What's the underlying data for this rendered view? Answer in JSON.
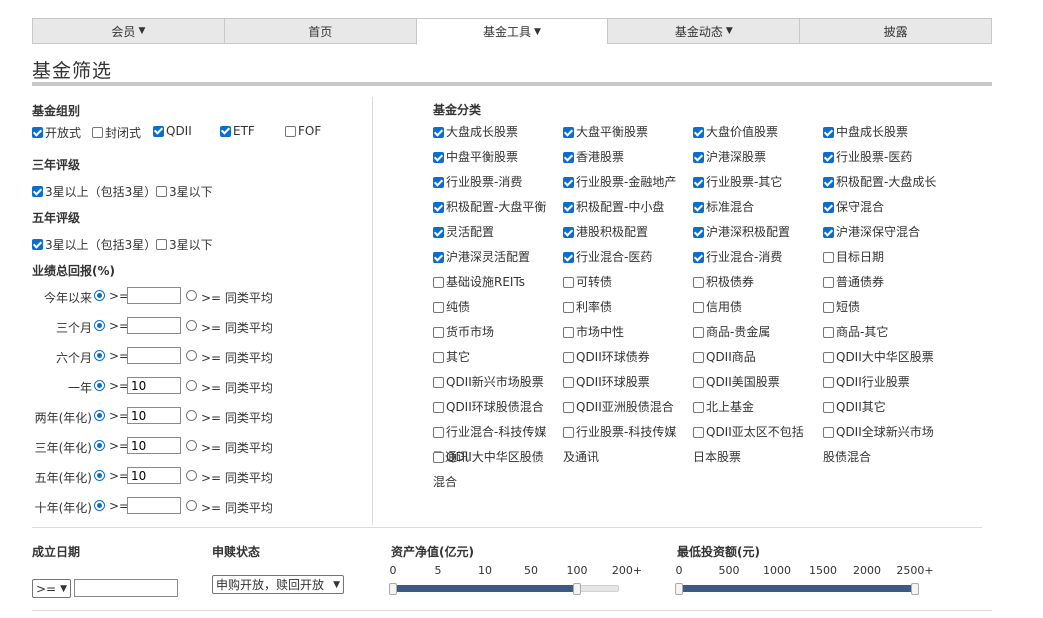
{
  "nav": {
    "tabs": [
      {
        "label": "会员",
        "dropdown": true
      },
      {
        "label": "首页",
        "dropdown": false
      },
      {
        "label": "基金工具",
        "dropdown": true,
        "active": true
      },
      {
        "label": "基金动态",
        "dropdown": true
      },
      {
        "label": "披露",
        "dropdown": false
      }
    ]
  },
  "page_title": "基金筛选",
  "fund_group": {
    "title": "基金组别",
    "items": [
      {
        "label": "开放式",
        "checked": true
      },
      {
        "label": "封闭式",
        "checked": false
      },
      {
        "label": "QDII",
        "checked": true
      },
      {
        "label": "ETF",
        "checked": true
      },
      {
        "label": "FOF",
        "checked": false
      }
    ]
  },
  "rating3": {
    "title": "三年评级",
    "items": [
      {
        "label": "3星以上（包括3星）",
        "checked": true
      },
      {
        "label": "3星以下",
        "checked": false
      }
    ]
  },
  "rating5": {
    "title": "五年评级",
    "items": [
      {
        "label": "3星以上（包括3星）",
        "checked": true
      },
      {
        "label": "3星以下",
        "checked": false
      }
    ]
  },
  "performance": {
    "title": "业绩总回报(%)",
    "gte_label": ">=",
    "avg_label": ">= 同类平均",
    "rows": [
      {
        "label": "今年以来",
        "value": ""
      },
      {
        "label": "三个月",
        "value": ""
      },
      {
        "label": "六个月",
        "value": ""
      },
      {
        "label": "一年",
        "value": "10"
      },
      {
        "label": "两年(年化)",
        "value": "10"
      },
      {
        "label": "三年(年化)",
        "value": "10"
      },
      {
        "label": "五年(年化)",
        "value": "10"
      },
      {
        "label": "十年(年化)",
        "value": ""
      }
    ]
  },
  "categories": {
    "title": "基金分类",
    "items": [
      {
        "label": "大盘成长股票",
        "checked": true
      },
      {
        "label": "大盘平衡股票",
        "checked": true
      },
      {
        "label": "大盘价值股票",
        "checked": true
      },
      {
        "label": "中盘成长股票",
        "checked": true
      },
      {
        "label": "中盘平衡股票",
        "checked": true
      },
      {
        "label": "香港股票",
        "checked": true
      },
      {
        "label": "沪港深股票",
        "checked": true
      },
      {
        "label": "行业股票-医药",
        "checked": true
      },
      {
        "label": "行业股票-消费",
        "checked": true
      },
      {
        "label": "行业股票-金融地产",
        "checked": true
      },
      {
        "label": "行业股票-其它",
        "checked": true
      },
      {
        "label": "积极配置-大盘成长",
        "checked": true
      },
      {
        "label": "积极配置-大盘平衡",
        "checked": true
      },
      {
        "label": "积极配置-中小盘",
        "checked": true
      },
      {
        "label": "标准混合",
        "checked": true
      },
      {
        "label": "保守混合",
        "checked": true
      },
      {
        "label": "灵活配置",
        "checked": true
      },
      {
        "label": "港股积极配置",
        "checked": true
      },
      {
        "label": "沪港深积极配置",
        "checked": true
      },
      {
        "label": "沪港深保守混合",
        "checked": true
      },
      {
        "label": "沪港深灵活配置",
        "checked": true
      },
      {
        "label": "行业混合-医药",
        "checked": true
      },
      {
        "label": "行业混合-消费",
        "checked": true
      },
      {
        "label": "目标日期",
        "checked": false
      },
      {
        "label": "基础设施REITs",
        "checked": false
      },
      {
        "label": "可转债",
        "checked": false
      },
      {
        "label": "积极债券",
        "checked": false
      },
      {
        "label": "普通债券",
        "checked": false
      },
      {
        "label": "纯债",
        "checked": false
      },
      {
        "label": "利率债",
        "checked": false
      },
      {
        "label": "信用债",
        "checked": false
      },
      {
        "label": "短债",
        "checked": false
      },
      {
        "label": "货币市场",
        "checked": false
      },
      {
        "label": "市场中性",
        "checked": false
      },
      {
        "label": "商品-贵金属",
        "checked": false
      },
      {
        "label": "商品-其它",
        "checked": false
      },
      {
        "label": "其它",
        "checked": false
      },
      {
        "label": "QDII环球债券",
        "checked": false
      },
      {
        "label": "QDII商品",
        "checked": false
      },
      {
        "label": "QDII大中华区股票",
        "checked": false
      },
      {
        "label": "QDII新兴市场股票",
        "checked": false
      },
      {
        "label": "QDII环球股票",
        "checked": false
      },
      {
        "label": "QDII美国股票",
        "checked": false
      },
      {
        "label": "QDII行业股票",
        "checked": false
      },
      {
        "label": "QDII环球股债混合",
        "checked": false
      },
      {
        "label": "QDII亚洲股债混合",
        "checked": false
      },
      {
        "label": "北上基金",
        "checked": false
      },
      {
        "label": "QDII其它",
        "checked": false
      },
      {
        "label": "行业混合-科技传媒及通讯",
        "checked": false,
        "wrap": [
          "行业混合-科技传媒",
          "及通讯"
        ]
      },
      {
        "label": "行业股票-科技传媒及通讯",
        "checked": false,
        "wrap": [
          "行业股票-科技传媒",
          "及通讯"
        ]
      },
      {
        "label": "QDII亚太区不包括日本股票",
        "checked": false,
        "wrap": [
          "QDII亚太区不包括",
          "日本股票"
        ]
      },
      {
        "label": "QDII全球新兴市场股债混合",
        "checked": false,
        "wrap": [
          "QDII全球新兴市场",
          "股债混合"
        ]
      },
      {
        "label": "QDII大中华区股债混合",
        "checked": false,
        "wrap": [
          "QDII大中华区股债",
          "混合"
        ]
      }
    ]
  },
  "inception": {
    "title": "成立日期",
    "operator": ">=",
    "value": ""
  },
  "subscription": {
    "title": "申赎状态",
    "selected": "申购开放，赎回开放"
  },
  "nav_asset": {
    "title": "资产净值(亿元)",
    "ticks": [
      "0",
      "5",
      "10",
      "50",
      "100",
      "200+"
    ],
    "selected_min": "0",
    "selected_max": "100"
  },
  "min_invest": {
    "title": "最低投资额(元)",
    "ticks": [
      "0",
      "500",
      "1000",
      "1500",
      "2000",
      "2500+"
    ],
    "selected_min": "0",
    "selected_max": "2500+"
  }
}
